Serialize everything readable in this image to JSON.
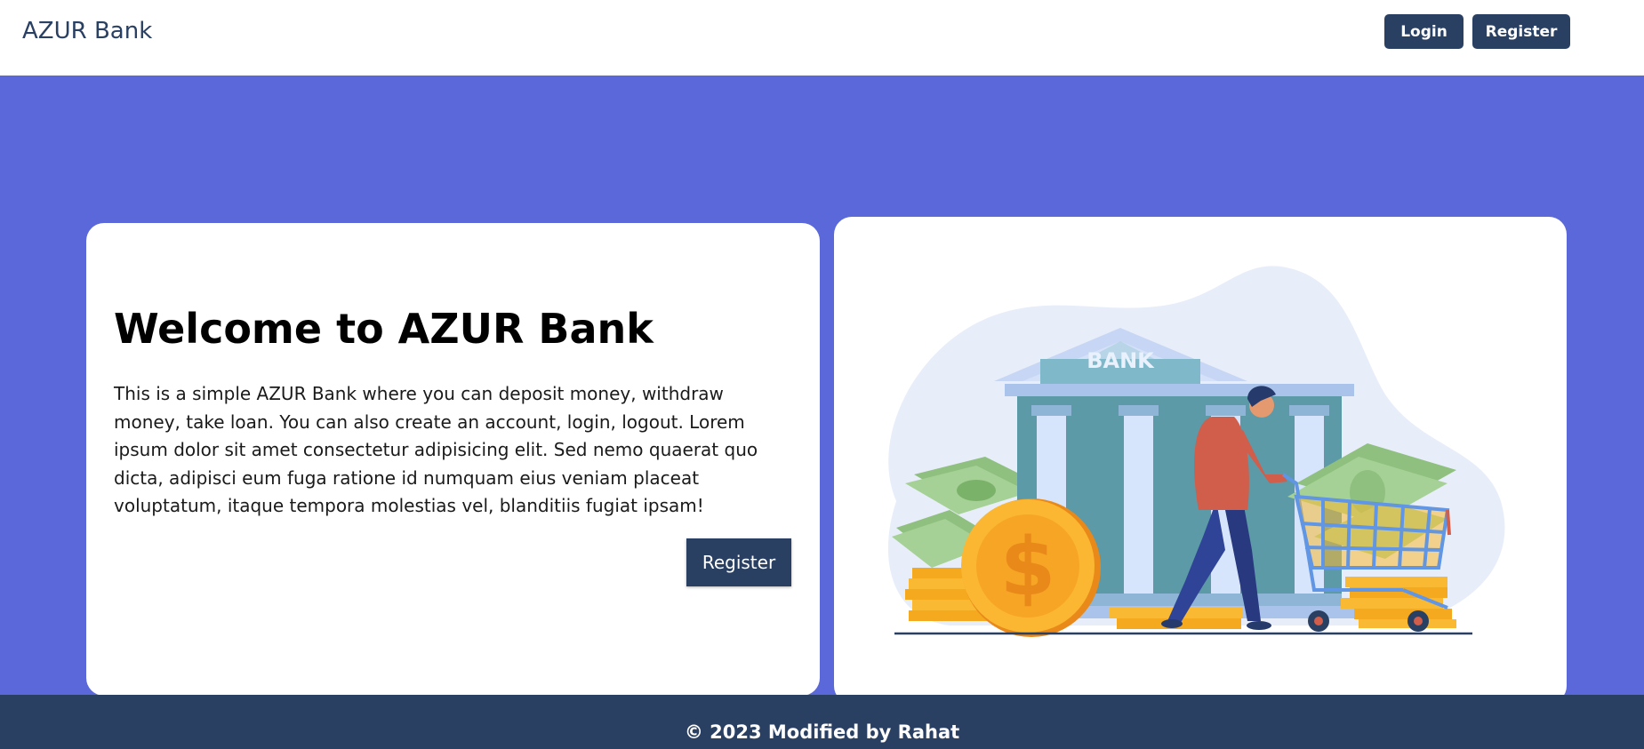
{
  "navbar": {
    "brand": "AZUR Bank",
    "login_label": "Login",
    "register_label": "Register"
  },
  "hero": {
    "title": "Welcome to AZUR Bank",
    "description": "This is a simple AZUR Bank where you can deposit money, withdraw money, take loan. You can also create an account, login, logout. Lorem ipsum dolor sit amet consectetur adipisicing elit. Sed nemo quaerat quo dicta, adipisci eum fuga ratione id numquam eius veniam placeat voluptatum, itaque tempora molestias vel, blanditiis fugiat ipsam!",
    "register_label": "Register"
  },
  "illustration": {
    "bank_sign": "BANK",
    "coin_symbol": "$"
  },
  "footer": {
    "text": "© 2023 Modified by Rahat"
  },
  "colors": {
    "page_background": "#5b68d9",
    "primary": "#2a4063",
    "card": "#ffffff"
  }
}
